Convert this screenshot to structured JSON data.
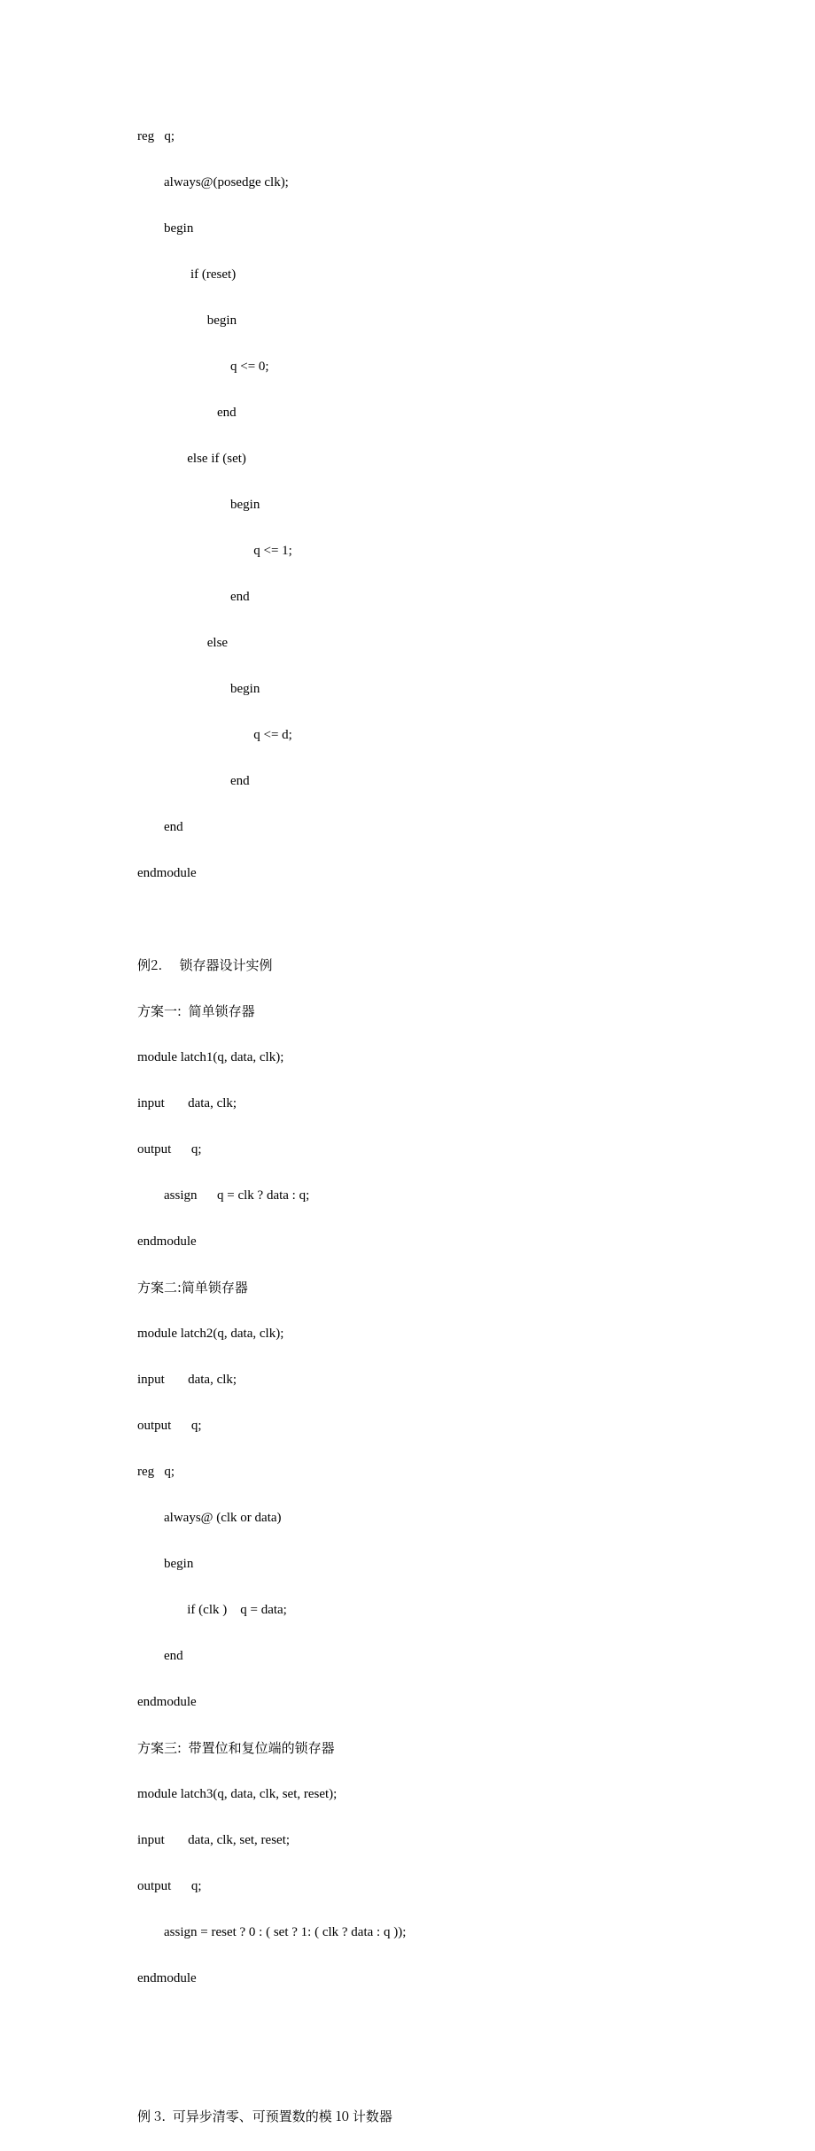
{
  "code_block_1": {
    "lines": [
      "reg   q;",
      "        always@(posedge clk);",
      "        begin",
      "                if (reset)",
      "                     begin",
      "                            q <= 0;",
      "                        end",
      "               else if (set)",
      "                            begin",
      "                                   q <= 1;",
      "                            end",
      "                     else",
      "                            begin",
      "                                   q <= d;",
      "                            end",
      "        end",
      "endmodule"
    ]
  },
  "blank1": "",
  "example2_header": "例2.     锁存器设计实例",
  "scheme1_label": "方案一:  简单锁存器",
  "code_block_2": {
    "lines": [
      "module latch1(q, data, clk);",
      "input       data, clk;",
      "output      q;",
      "        assign      q = clk ? data : q;",
      "endmodule"
    ]
  },
  "scheme2_label": "方案二:简单锁存器",
  "code_block_3": {
    "lines": [
      "module latch2(q, data, clk);",
      "input       data, clk;",
      "output      q;",
      "reg   q;",
      "        always@ (clk or data)",
      "        begin",
      "               if (clk )    q = data;",
      "        end",
      "endmodule"
    ]
  },
  "scheme3_label": "方案三:  带置位和复位端的锁存器",
  "code_block_4": {
    "lines": [
      "module latch3(q, data, clk, set, reset);",
      "input       data, clk, set, reset;",
      "output      q;",
      "        assign = reset ? 0 : ( set ? 1: ( clk ? data : q ));",
      "endmodule"
    ]
  },
  "blank2": "",
  "blank3": "",
  "example3_header": "例 3.  可异步清零、可预置数的模 10 计数器"
}
